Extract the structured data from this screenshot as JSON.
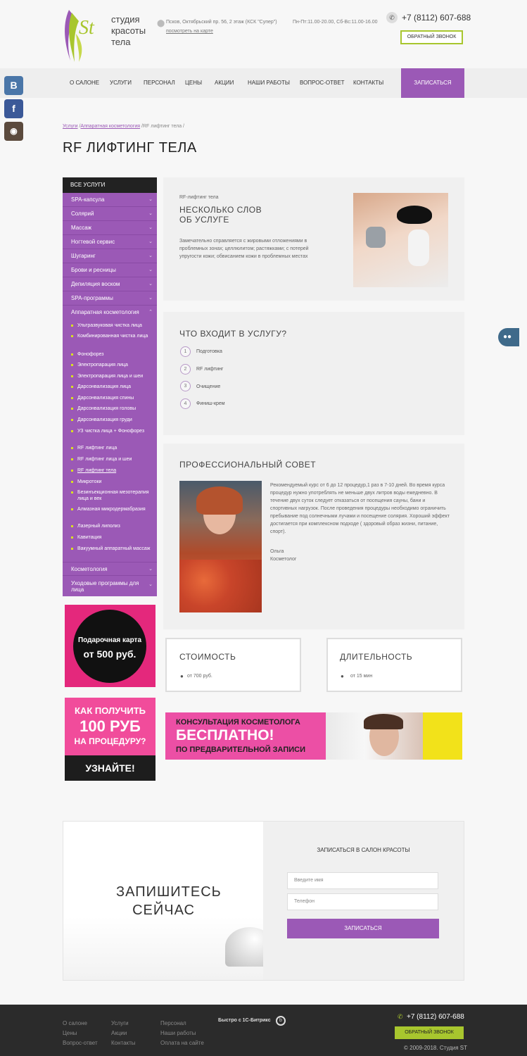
{
  "header": {
    "logo_mark": "St",
    "logo_line1": "студия",
    "logo_line2": "красоты",
    "logo_line3": "тела",
    "address": "Псков, Октябрьский пр. 56, 2 этаж (КСК \"Супер\")",
    "map_link": "посмотреть на карте",
    "hours": "Пн-Пт:11.00-20.00, Сб-Вс:11.00-16.00",
    "phone": "+7 (8112) 607-688",
    "callback": "Обратный звонок"
  },
  "nav": {
    "items": [
      "О салоне",
      "Услуги",
      "Персонал",
      "Цены",
      "Акции",
      "Наши работы",
      "Вопрос-ответ",
      "Контакты"
    ],
    "cta": "Записаться"
  },
  "social": [
    "В",
    "f",
    "◉"
  ],
  "breadcrumb": {
    "item1": "Услуги",
    "item2": "Аппаратная косметология",
    "current": "RF лифтинг тела"
  },
  "page_title": "RF ЛИФТИНГ ТЕЛА",
  "sidebar": {
    "header": "Все услуги",
    "categories": [
      "SPA-капсула",
      "Солярий",
      "Массаж",
      "Ногтевой сервис",
      "Шугаринг",
      "Брови и ресницы",
      "Депиляция воском",
      "SPA-программы",
      "Аппаратная косметология"
    ],
    "subitems": [
      "Ультразвуковая чистка лица",
      "Комбинированная чистка лица",
      "Фонофорез",
      "Электропарация лица",
      "Электропарация лица и шеи",
      "Дарсонвализация лица",
      "Дарсонвализация спины",
      "Дарсонвализация головы",
      "Дарсонвализация груди",
      "УЗ чистка лица + Фонофорез",
      "RF лифтинг лица",
      "RF лифтинг лица и шеи",
      "RF лифтинг тела",
      "Микротоки",
      "Безинъекционная мезотерапия лица и век",
      "Алмазная микродермабразия",
      "Лазерный липолиз",
      "Кавитация",
      "Вакуумный аппаратный массаж"
    ],
    "bottom_categories": [
      "Косметология",
      "Уходовые программы для лица"
    ]
  },
  "promo": {
    "gift_line1": "Подарочная карта",
    "gift_line2": "от 500 руб.",
    "p100_line1": "КАК ПОЛУЧИТЬ",
    "p100_line2": "100 РУБ",
    "p100_line3": "НА ПРОЦЕДУРУ?",
    "p100_cta": "УЗНАЙТЕ!"
  },
  "about": {
    "label": "RF-лифтинг тела",
    "heading1": "Несколько слов",
    "heading2": "об услуге",
    "text": "Замечательно справляется с жировыми отложениями в проблемных зонах; целлюлитом; растяжками; с потерей упругости кожи; обвисанием кожи в проблемных местах"
  },
  "steps": {
    "heading": "Что входит в услугу?",
    "items": [
      {
        "n": "1",
        "label": "Подготовка"
      },
      {
        "n": "2",
        "label": "RF лифтинг"
      },
      {
        "n": "3",
        "label": "Очищение"
      },
      {
        "n": "4",
        "label": "Финиш-крем"
      }
    ]
  },
  "advice": {
    "heading": "Профессиональный совет",
    "text": "Рекомендуемый курс от 6 до 12 процедур,1 раз в 7-10 дней. Во время курса процедур нужно употреблять не меньше двух литров воды ежедневно. В течение двух суток следует отказаться от посещения сауны, бани и спортивных нагрузок. После проведения процедуры необходимо ограничить пребывание под солнечными лучами и посещение солярия. Хороший эффект достигается при комплексном подходе ( здоровый образ жизни, питание, спорт).",
    "name": "Ольга",
    "role": "Косметолог"
  },
  "price": {
    "heading": "Стоимость",
    "value": "от 700 руб."
  },
  "duration": {
    "heading": "Длительность",
    "value": "от 15 мин"
  },
  "consult": {
    "line1": "КОНСУЛЬТАЦИЯ КОСМЕТОЛОГА",
    "line2": "БЕСПЛАТНО!",
    "line3": "ПО ПРЕДВАРИТЕЛЬНОЙ ЗАПИСИ"
  },
  "signup": {
    "left1": "ЗАПИШИТЕСЬ",
    "left2": "СЕЙЧАС",
    "title": "Записаться в салон красоты",
    "name_ph": "Введите имя",
    "phone_ph": "Телефон",
    "submit": "Записаться"
  },
  "footer": {
    "col1": [
      "О салоне",
      "Цены",
      "Вопрос-ответ"
    ],
    "col2": [
      "Услуги",
      "Акции",
      "Контакты"
    ],
    "col3": [
      "Персонал",
      "Наши работы",
      "Оплата на сайте"
    ],
    "bitrix": "Быстро с 1С-Битрикс",
    "phone": "+7 (8112) 607-688",
    "callback": "Обратный звонок",
    "copyright": "© 2009-2018. Студия ST"
  },
  "colors": {
    "accent": "#9b59b6",
    "lime": "#a8c62e",
    "pink": "#ec4fa5",
    "dark": "#2b2b2b"
  }
}
